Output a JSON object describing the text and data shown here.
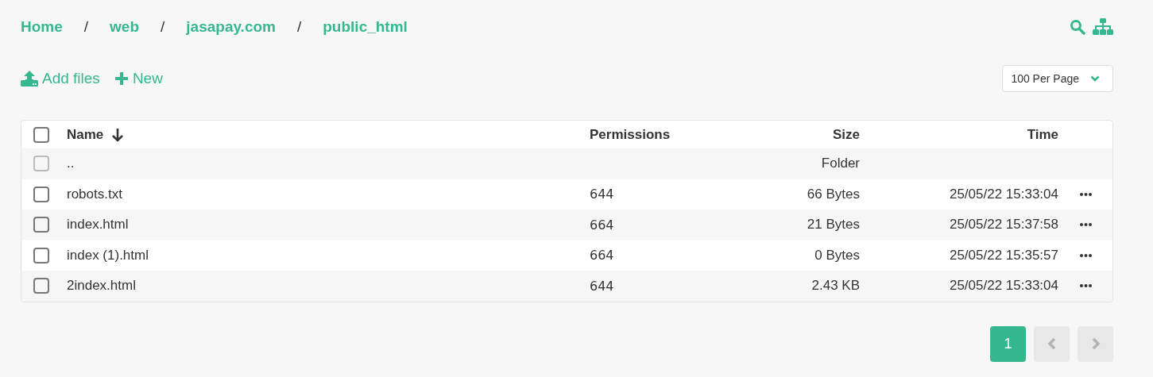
{
  "breadcrumb": [
    {
      "label": "Home"
    },
    {
      "label": "web"
    },
    {
      "label": "jasapay.com"
    },
    {
      "label": "public_html"
    }
  ],
  "breadcrumb_separators": [
    "/",
    "/",
    "/"
  ],
  "toolbar": {
    "add_files": "Add files",
    "new": "New",
    "per_page": "100 Per Page"
  },
  "table": {
    "header_checked": false,
    "columns": [
      {
        "label": "Name",
        "sorted": true
      },
      {
        "label": "Permissions",
        "sorted": false
      },
      {
        "label": "Size",
        "sorted": false
      },
      {
        "label": "Time",
        "sorted": false
      }
    ],
    "rows": [
      {
        "kind": "parent",
        "name": "..",
        "permissions": "",
        "size": "Folder",
        "time": "",
        "checked": false,
        "disabled": true
      },
      {
        "kind": "file",
        "name": "robots.txt",
        "permissions": "644",
        "size": "66 Bytes",
        "time": "25/05/22 15:33:04",
        "checked": false,
        "disabled": false
      },
      {
        "kind": "file",
        "name": "index.html",
        "permissions": "664",
        "size": "21 Bytes",
        "time": "25/05/22 15:37:58",
        "checked": false,
        "disabled": false
      },
      {
        "kind": "file",
        "name": "index (1).html",
        "permissions": "664",
        "size": "0 Bytes",
        "time": "25/05/22 15:35:57",
        "checked": false,
        "disabled": false
      },
      {
        "kind": "file",
        "name": "2index.html",
        "permissions": "644",
        "size": "2.43 KB",
        "time": "25/05/22 15:33:04",
        "checked": false,
        "disabled": false
      }
    ]
  },
  "pagination": {
    "pages": [
      {
        "label": "1",
        "selected": true
      }
    ],
    "prev_disabled": true,
    "next_disabled": true
  }
}
